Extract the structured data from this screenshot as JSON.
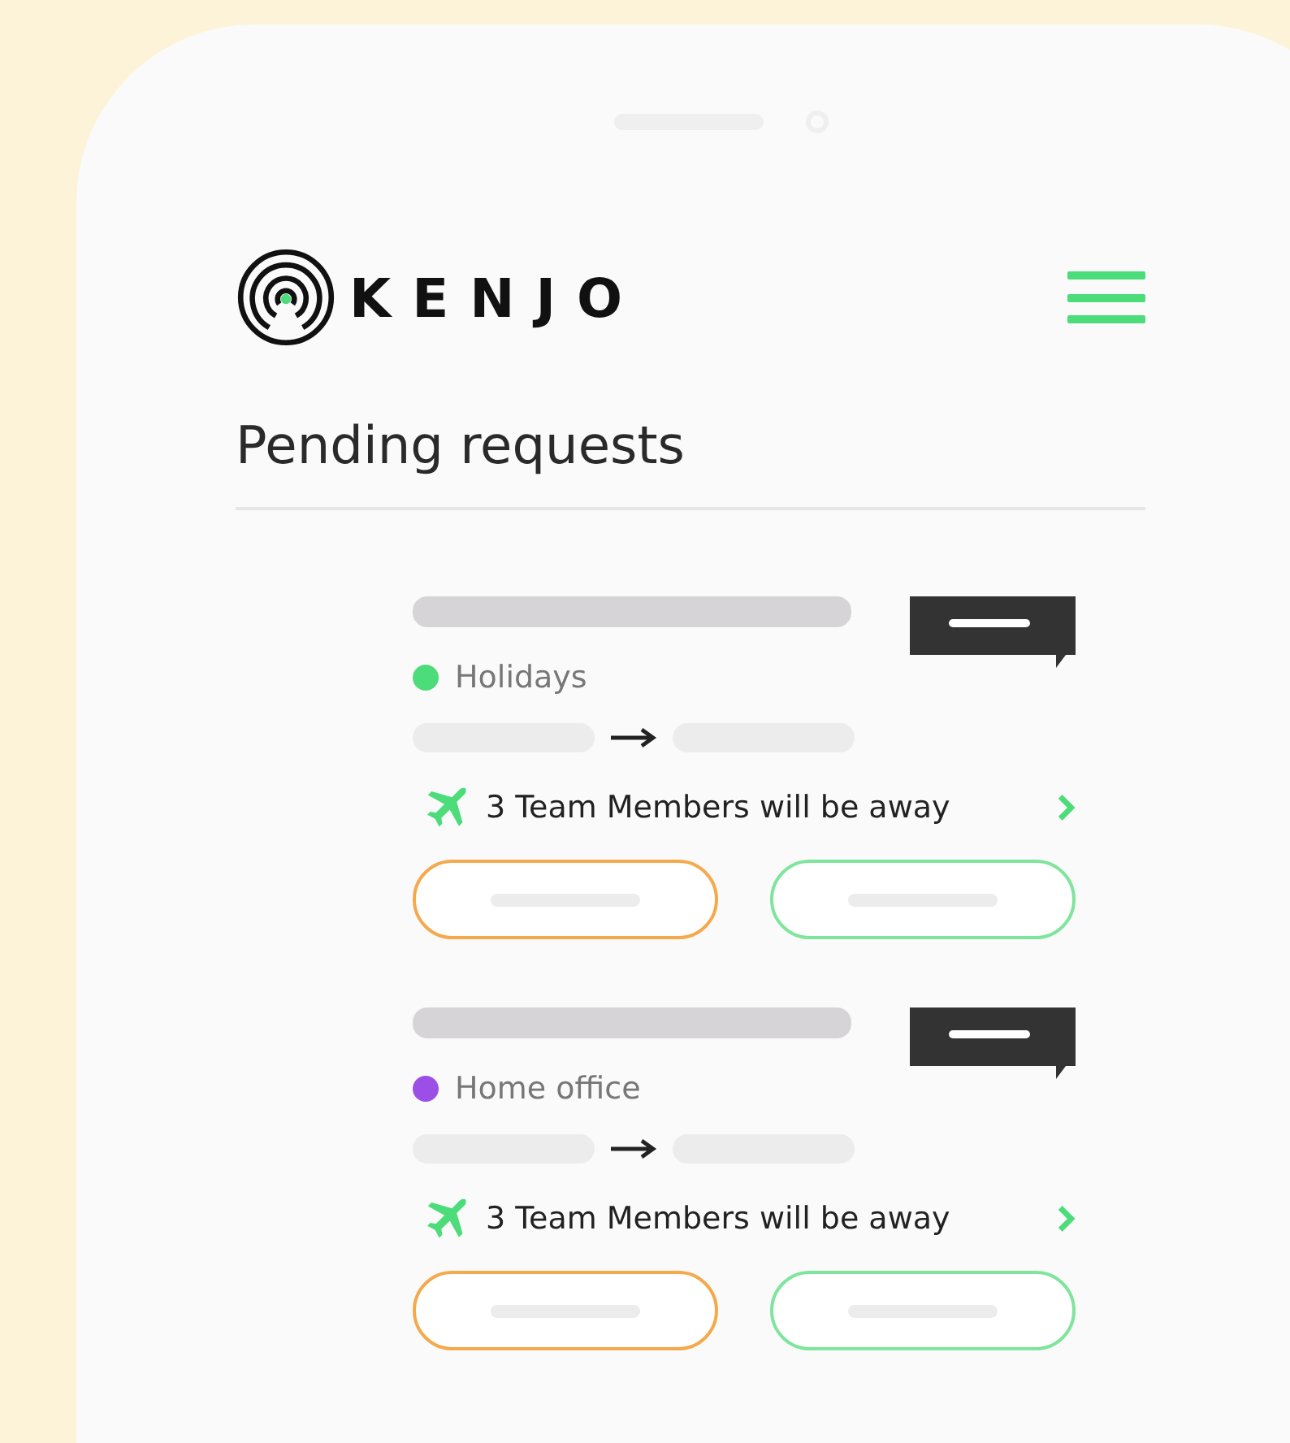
{
  "logo": {
    "text": "KENJO"
  },
  "title": "Pending requests",
  "requests": [
    {
      "category": "Holidays",
      "color": "#4cdc7a",
      "away_notice": "3 Team Members will be away"
    },
    {
      "category": "Home office",
      "color": "#9b4fe6",
      "away_notice": "3 Team Members will be away"
    }
  ]
}
